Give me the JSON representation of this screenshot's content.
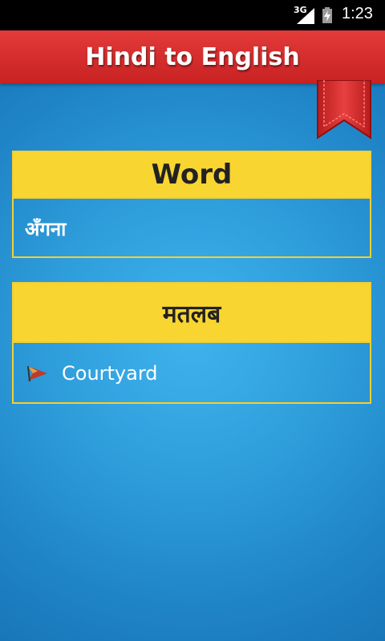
{
  "status": {
    "network": "3G",
    "time": "1:23"
  },
  "header": {
    "title": "Hindi to English"
  },
  "word_card": {
    "heading": "Word",
    "value": "अँगना"
  },
  "meaning_card": {
    "heading": "मतलब",
    "items": [
      {
        "text": "Courtyard",
        "icon": "flag-bullet-icon"
      }
    ]
  },
  "colors": {
    "header_red": "#d42a2a",
    "card_yellow": "#f9d531",
    "background_blue": "#2f9fdc"
  }
}
